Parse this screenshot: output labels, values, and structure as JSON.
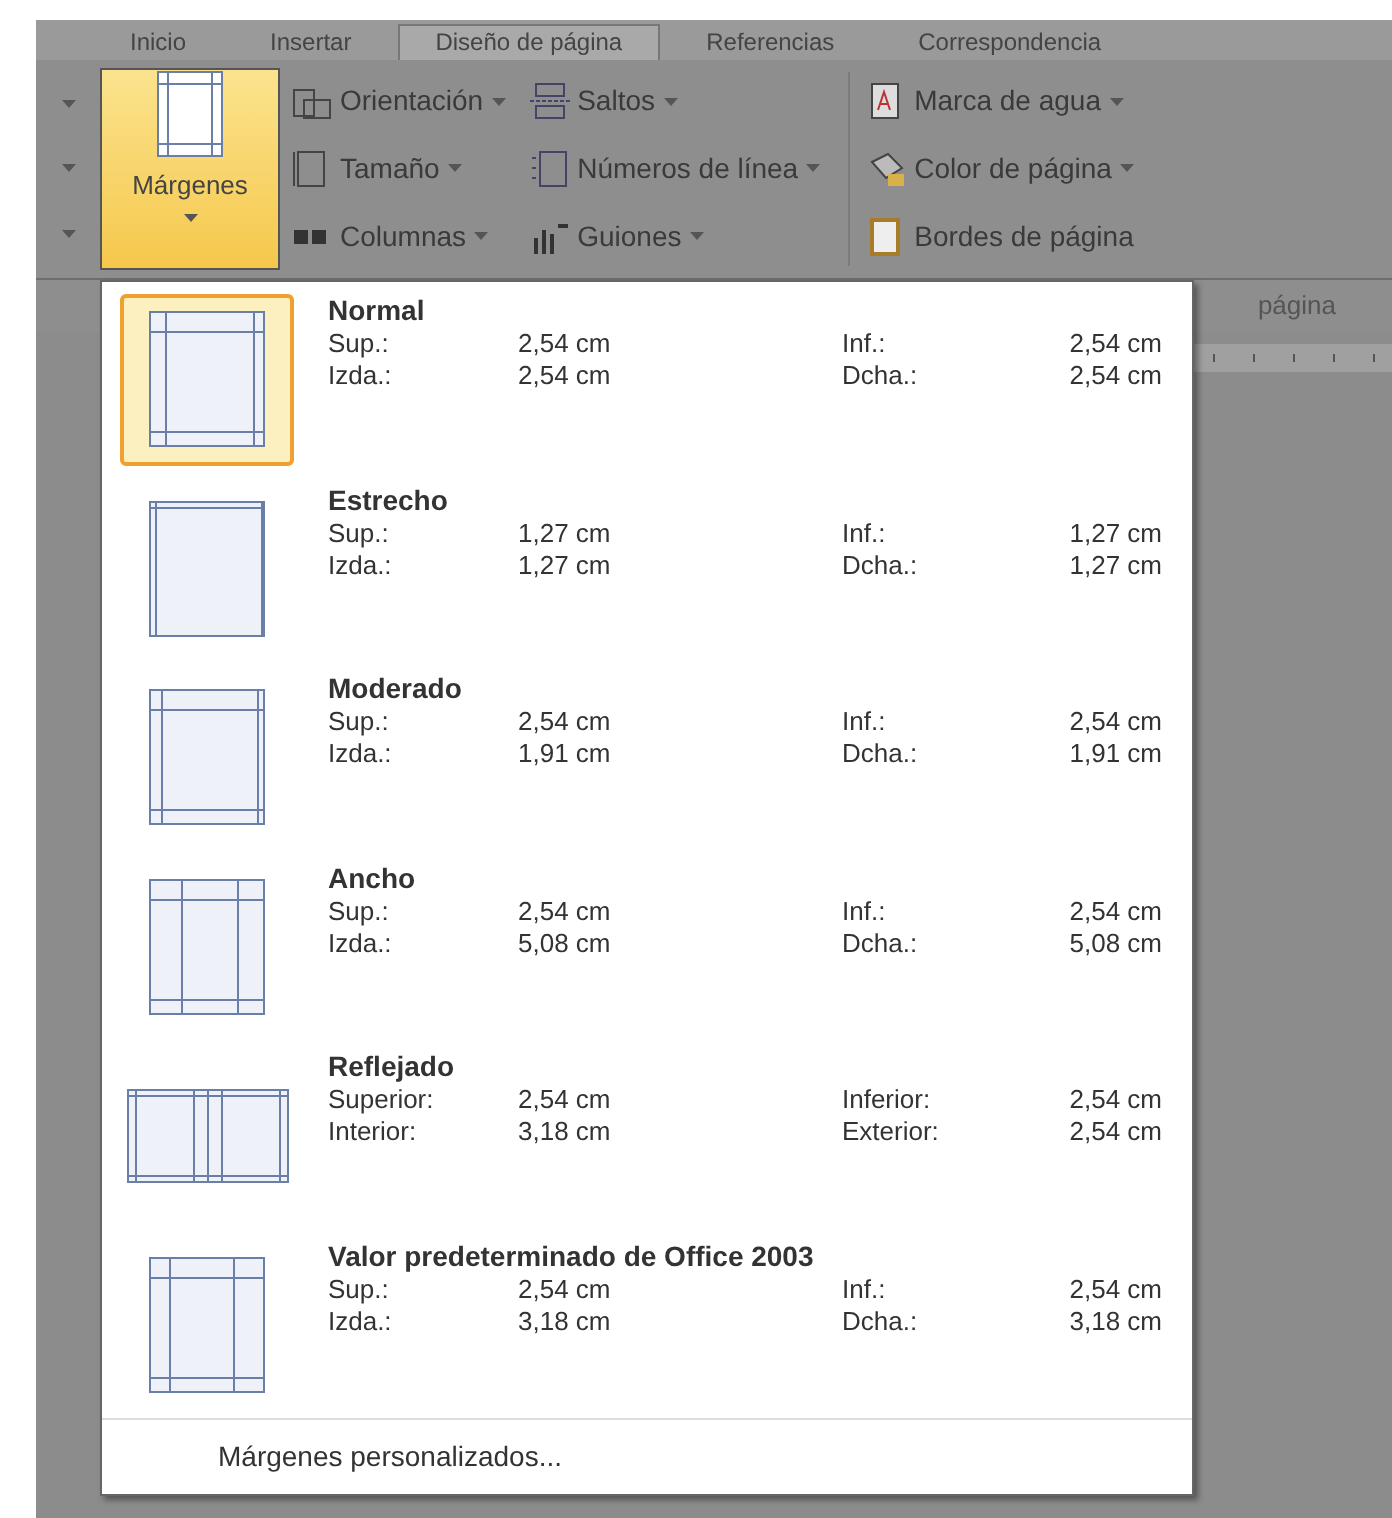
{
  "tabs": [
    {
      "label": "Inicio",
      "selected": false
    },
    {
      "label": "Insertar",
      "selected": false
    },
    {
      "label": "Diseño de página",
      "selected": true
    },
    {
      "label": "Referencias",
      "selected": false
    },
    {
      "label": "Correspondencia",
      "selected": false
    }
  ],
  "ribbon": {
    "margins_button": {
      "label": "Márgenes",
      "pressed": true
    },
    "columns": [
      [
        {
          "label": "Orientación"
        },
        {
          "label": "Tamaño"
        },
        {
          "label": "Columnas"
        }
      ],
      [
        {
          "label": "Saltos"
        },
        {
          "label": "Números de línea"
        },
        {
          "label": "Guiones"
        }
      ],
      [
        {
          "label": "Marca de agua"
        },
        {
          "label": "Color de página"
        },
        {
          "label": "Bordes de página"
        }
      ]
    ],
    "group_label": "página"
  },
  "margins_menu": {
    "presets": [
      {
        "kind": "normal",
        "name": "Normal",
        "selected": true,
        "rows": [
          {
            "label_1": "Sup.:",
            "value_1": "2,54 cm",
            "label_2": "Inf.:",
            "value_2": "2,54 cm"
          },
          {
            "label_1": "Izda.:",
            "value_1": "2,54 cm",
            "label_2": "Dcha.:",
            "value_2": "2,54 cm"
          }
        ]
      },
      {
        "kind": "narrow",
        "name": "Estrecho",
        "selected": false,
        "rows": [
          {
            "label_1": "Sup.:",
            "value_1": "1,27 cm",
            "label_2": "Inf.:",
            "value_2": "1,27 cm"
          },
          {
            "label_1": "Izda.:",
            "value_1": "1,27 cm",
            "label_2": "Dcha.:",
            "value_2": "1,27 cm"
          }
        ]
      },
      {
        "kind": "moderate",
        "name": "Moderado",
        "selected": false,
        "rows": [
          {
            "label_1": "Sup.:",
            "value_1": "2,54 cm",
            "label_2": "Inf.:",
            "value_2": "2,54 cm"
          },
          {
            "label_1": "Izda.:",
            "value_1": "1,91 cm",
            "label_2": "Dcha.:",
            "value_2": "1,91 cm"
          }
        ]
      },
      {
        "kind": "wide",
        "name": "Ancho",
        "selected": false,
        "rows": [
          {
            "label_1": "Sup.:",
            "value_1": "2,54 cm",
            "label_2": "Inf.:",
            "value_2": "2,54 cm"
          },
          {
            "label_1": "Izda.:",
            "value_1": "5,08 cm",
            "label_2": "Dcha.:",
            "value_2": "5,08 cm"
          }
        ]
      },
      {
        "kind": "mirrored",
        "name": "Reflejado",
        "selected": false,
        "rows": [
          {
            "label_1": "Superior:",
            "value_1": "2,54 cm",
            "label_2": "Inferior:",
            "value_2": "2,54 cm"
          },
          {
            "label_1": "Interior:",
            "value_1": "3,18 cm",
            "label_2": "Exterior:",
            "value_2": "2,54 cm"
          }
        ]
      },
      {
        "kind": "office2003",
        "name": "Valor predeterminado de Office 2003",
        "selected": false,
        "rows": [
          {
            "label_1": "Sup.:",
            "value_1": "2,54 cm",
            "label_2": "Inf.:",
            "value_2": "2,54 cm"
          },
          {
            "label_1": "Izda.:",
            "value_1": "3,18 cm",
            "label_2": "Dcha.:",
            "value_2": "3,18 cm"
          }
        ]
      }
    ],
    "custom_margins": "Márgenes personalizados..."
  }
}
